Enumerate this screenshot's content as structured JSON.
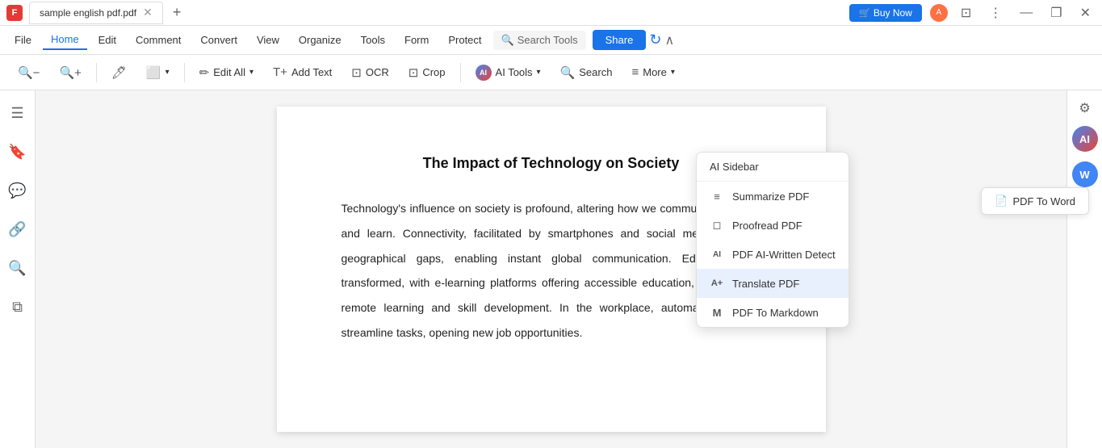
{
  "titlebar": {
    "icon_label": "F",
    "tab_title": "sample english pdf.pdf",
    "buy_now": "🛒 Buy Now",
    "controls": [
      "—",
      "❐",
      "✕"
    ]
  },
  "menubar": {
    "items": [
      {
        "id": "file",
        "label": "File"
      },
      {
        "id": "home",
        "label": "Home",
        "active": true
      },
      {
        "id": "edit",
        "label": "Edit"
      },
      {
        "id": "comment",
        "label": "Comment"
      },
      {
        "id": "convert",
        "label": "Convert"
      },
      {
        "id": "view",
        "label": "View"
      },
      {
        "id": "organize",
        "label": "Organize"
      },
      {
        "id": "tools",
        "label": "Tools"
      },
      {
        "id": "form",
        "label": "Form"
      },
      {
        "id": "protect",
        "label": "Protect"
      }
    ],
    "search_tools": "Search Tools",
    "share": "Share"
  },
  "toolbar": {
    "zoom_out": "zoom-out",
    "zoom_in": "zoom-in",
    "highlight": "highlight",
    "shape": "shape",
    "edit_all": "Edit All",
    "add_text": "Add Text",
    "ocr": "OCR",
    "crop": "Crop",
    "ai_tools": "AI Tools",
    "search": "Search",
    "more": "More"
  },
  "dropdown": {
    "header": "AI Sidebar",
    "items": [
      {
        "id": "summarize",
        "label": "Summarize PDF",
        "icon": "≡"
      },
      {
        "id": "proofread",
        "label": "Proofread PDF",
        "icon": "◻"
      },
      {
        "id": "ai-detect",
        "label": "PDF AI-Written Detect",
        "icon": "AI"
      },
      {
        "id": "translate",
        "label": "Translate PDF",
        "icon": "A+",
        "highlighted": true
      },
      {
        "id": "markdown",
        "label": "PDF To Markdown",
        "icon": "M"
      }
    ]
  },
  "pdf": {
    "title": "The Impact of Technology on Society",
    "body": "Technology's influence on society is profound, altering how we communicate, work, and learn. Connectivity, facilitated by smartphones and social media, bridges geographical gaps, enabling instant global communication. Education has transformed, with e-learning platforms offering accessible education, empowering remote learning and skill development. In the workplace, automation and AI streamline tasks, opening new job opportunities."
  },
  "pdf_to_word_label": "PDF To Word",
  "sidebar_left": {
    "icons": [
      "☰",
      "🔖",
      "💬",
      "🔗",
      "🔍",
      "⧉"
    ]
  },
  "sidebar_right": {
    "settings_icon": "⚙"
  }
}
